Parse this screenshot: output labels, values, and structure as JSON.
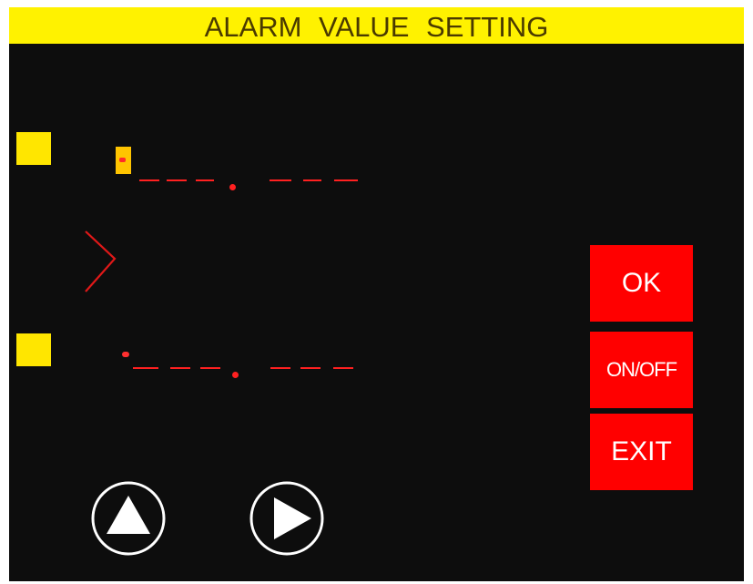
{
  "header": {
    "title": "ALARM  VALUE  SETTING"
  },
  "buttons": {
    "ok": "OK",
    "onoff": "ON/OFF",
    "exit": "EXIT"
  },
  "icons": {
    "indicator_upper": "square-indicator",
    "indicator_lower": "square-indicator",
    "comparison": "greater-than-icon",
    "up": "up-arrow-icon",
    "right": "right-arrow-icon"
  },
  "colors": {
    "title_bar": "#fff200",
    "background": "#0d0d0d",
    "segment": "#ff2020",
    "button": "#ff0000",
    "indicator": "#ffe600"
  }
}
